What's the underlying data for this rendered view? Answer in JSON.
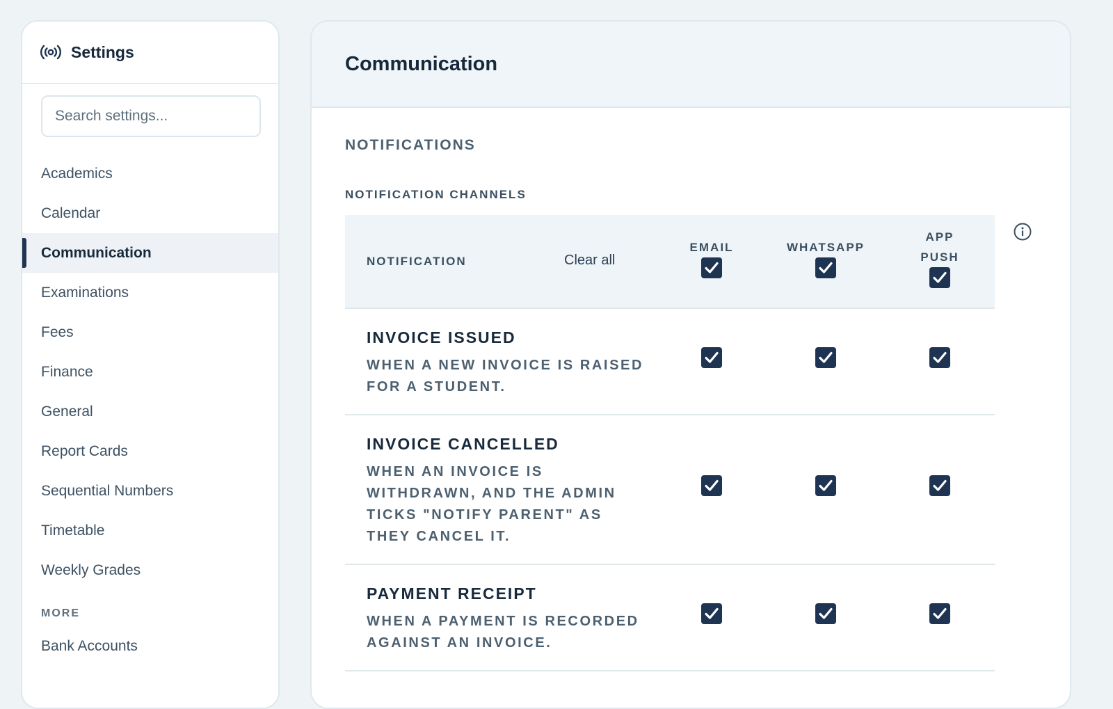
{
  "sidebar": {
    "title": "Settings",
    "search_placeholder": "Search settings...",
    "items": [
      {
        "label": "Academics"
      },
      {
        "label": "Calendar"
      },
      {
        "label": "Communication",
        "active": true
      },
      {
        "label": "Examinations"
      },
      {
        "label": "Fees"
      },
      {
        "label": "Finance"
      },
      {
        "label": "General"
      },
      {
        "label": "Report Cards"
      },
      {
        "label": "Sequential Numbers"
      },
      {
        "label": "Timetable"
      },
      {
        "label": "Weekly Grades"
      }
    ],
    "more_label": "MORE",
    "more_items": [
      {
        "label": "Bank Accounts"
      }
    ]
  },
  "main": {
    "title": "Communication",
    "section_title": "NOTIFICATIONS",
    "sub_title": "NOTIFICATION CHANNELS",
    "table": {
      "col_notification": "NOTIFICATION",
      "clear_all": "Clear all",
      "channels": [
        {
          "label": "EMAIL",
          "all_checked": true
        },
        {
          "label": "WHATSAPP",
          "all_checked": true
        },
        {
          "label": "APP PUSH",
          "all_checked": true
        }
      ],
      "rows": [
        {
          "name": "INVOICE ISSUED",
          "description": "WHEN A NEW INVOICE IS RAISED FOR A STUDENT.",
          "email": true,
          "whatsapp": true,
          "app_push": true
        },
        {
          "name": "INVOICE CANCELLED",
          "description": "WHEN AN INVOICE IS WITHDRAWN, AND THE ADMIN TICKS \"NOTIFY PARENT\" AS THEY CANCEL IT.",
          "email": true,
          "whatsapp": true,
          "app_push": true
        },
        {
          "name": "PAYMENT RECEIPT",
          "description": "WHEN A PAYMENT IS RECORDED AGAINST AN INVOICE.",
          "email": true,
          "whatsapp": true,
          "app_push": true
        }
      ]
    }
  },
  "colors": {
    "accent": "#1e3452",
    "background": "#eef4f6"
  },
  "icons": {
    "settings_header": "broadcast-icon",
    "info": "info-icon",
    "checkbox": "checkmark-icon"
  }
}
